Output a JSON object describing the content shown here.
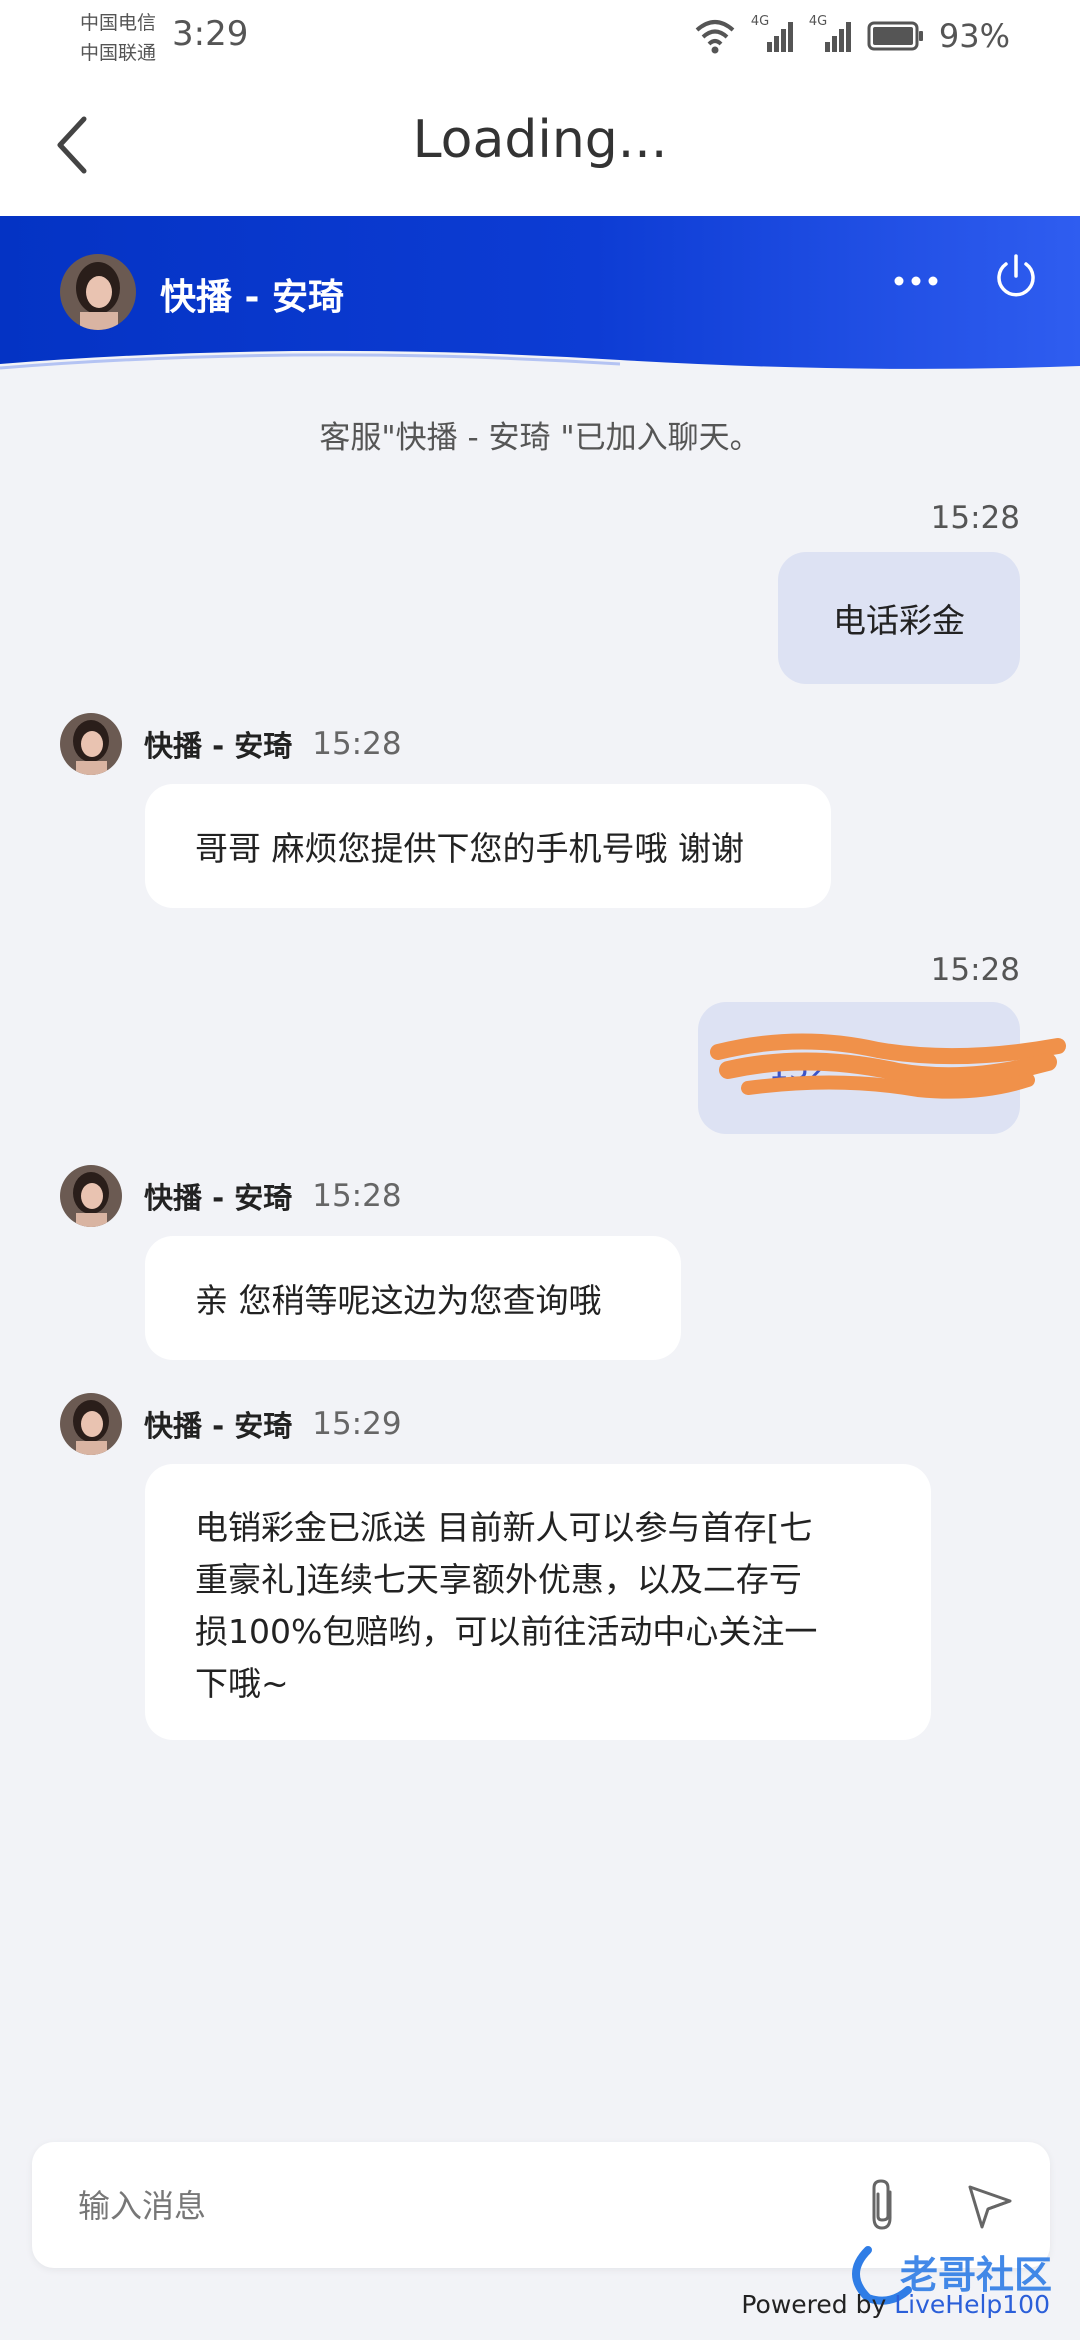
{
  "status_bar": {
    "carrier_1": "中国电信",
    "carrier_2": "中国联通",
    "time": "3:29",
    "network_1": "4G",
    "network_2": "4G",
    "battery": "93%"
  },
  "header": {
    "title": "Loading..."
  },
  "chat_header": {
    "agent_name": "快播 - 安琦"
  },
  "messages": {
    "system": "客服\"快播 - 安琦 \"已加入聊天。",
    "m1": {
      "time": "15:28",
      "text": "电话彩金"
    },
    "m2": {
      "sender": "快播 - 安琦",
      "time": "15:28",
      "text": "哥哥 麻烦您提供下您的手机号哦 谢谢"
    },
    "m3": {
      "time": "15:28",
      "text": "152"
    },
    "m4": {
      "sender": "快播 - 安琦",
      "time": "15:28",
      "text": "亲 您稍等呢这边为您查询哦"
    },
    "m5": {
      "sender": "快播 - 安琦",
      "time": "15:29",
      "lines": [
        "电销彩金已派送 目前新人可以参与首存[七",
        "重豪礼]连续七天享额外优惠，以及二存亏",
        "损100%包赔哟，可以前往活动中心关注一",
        "下哦~"
      ]
    }
  },
  "input": {
    "placeholder": "输入消息"
  },
  "footer": {
    "powered_prefix": "Powered by ",
    "powered_brand": "LiveHelp100"
  },
  "watermark_text": "老哥社区",
  "colors": {
    "header_blue": "#0433c4",
    "outgoing_bubble": "#dde2f3",
    "background": "#f2f3f7",
    "redaction": "#f0914a"
  },
  "icons": [
    "back-arrow-icon",
    "more-dots-icon",
    "power-icon",
    "paperclip-icon",
    "send-icon",
    "wifi-icon",
    "signal-icon",
    "battery-icon"
  ]
}
